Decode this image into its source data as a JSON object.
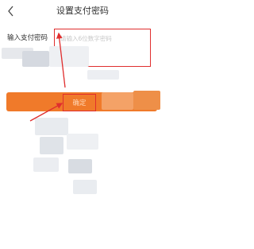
{
  "header": {
    "title": "设置支付密码",
    "back_icon": "chevron-left-icon"
  },
  "form": {
    "password_label": "输入支付密码",
    "password_placeholder": "请输入6位数字密码"
  },
  "actions": {
    "confirm_label": "确定"
  },
  "colors": {
    "accent": "#f07a2a",
    "annotation": "#e02e2e"
  }
}
